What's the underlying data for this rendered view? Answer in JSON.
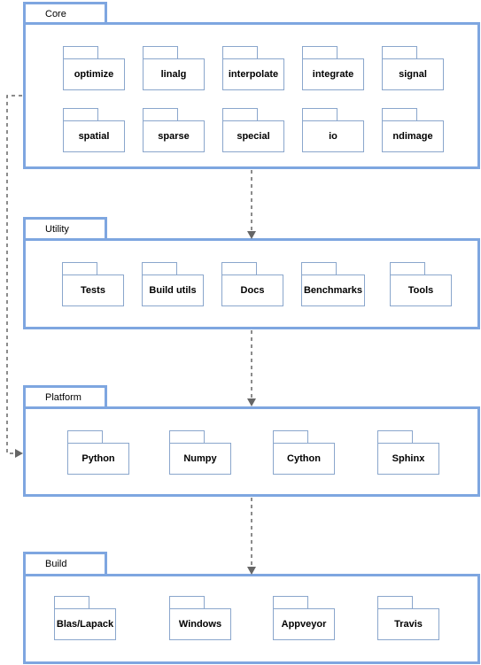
{
  "diagram": {
    "layers": [
      {
        "name": "Core",
        "packages": [
          "optimize",
          "linalg",
          "interpolate",
          "integrate",
          "signal",
          "spatial",
          "sparse",
          "special",
          "io",
          "ndimage"
        ]
      },
      {
        "name": "Utility",
        "packages": [
          "Tests",
          "Build utils",
          "Docs",
          "Benchmarks",
          "Tools"
        ]
      },
      {
        "name": "Platform",
        "packages": [
          "Python",
          "Numpy",
          "Cython",
          "Sphinx"
        ]
      },
      {
        "name": "Build",
        "packages": [
          "Blas/Lapack",
          "Windows",
          "Appveyor",
          "Travis"
        ]
      }
    ],
    "dependencies": [
      {
        "from": "Core",
        "to": "Utility",
        "style": "dashed"
      },
      {
        "from": "Utility",
        "to": "Platform",
        "style": "dashed"
      },
      {
        "from": "Platform",
        "to": "Build",
        "style": "dashed"
      },
      {
        "from": "Core",
        "to": "Platform",
        "style": "dashed"
      }
    ],
    "colors": {
      "frame_border": "#7ea6e0",
      "package_border": "#8aa6cc",
      "arrow": "#666666"
    }
  }
}
